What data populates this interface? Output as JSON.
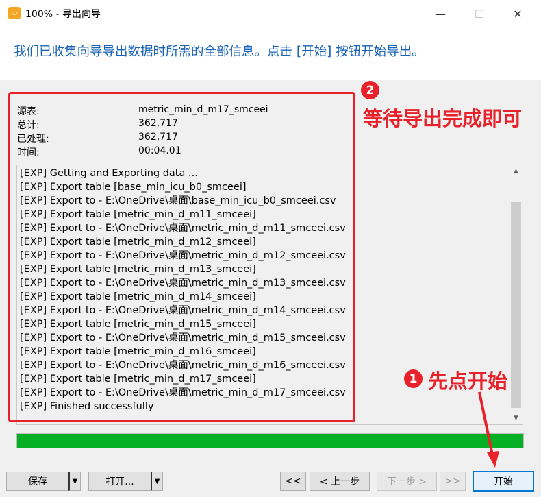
{
  "window": {
    "title": "100% - 导出向导",
    "minimize_glyph": "—",
    "maximize_glyph": "☐",
    "close_glyph": "✕"
  },
  "header": {
    "message": "我们已收集向导导出数据时所需的全部信息。点击 [开始] 按钮开始导出。"
  },
  "summary": [
    {
      "label": "源表:",
      "value": "metric_min_d_m17_smceei"
    },
    {
      "label": "总计:",
      "value": "362,717"
    },
    {
      "label": "已处理:",
      "value": "362,717"
    },
    {
      "label": "时间:",
      "value": "00:04.01"
    }
  ],
  "log": [
    "[EXP] Getting and Exporting data ...",
    "[EXP] Export table [base_min_icu_b0_smceei]",
    "[EXP] Export to - E:\\OneDrive\\桌面\\base_min_icu_b0_smceei.csv",
    "[EXP] Export table [metric_min_d_m11_smceei]",
    "[EXP] Export to - E:\\OneDrive\\桌面\\metric_min_d_m11_smceei.csv",
    "[EXP] Export table [metric_min_d_m12_smceei]",
    "[EXP] Export to - E:\\OneDrive\\桌面\\metric_min_d_m12_smceei.csv",
    "[EXP] Export table [metric_min_d_m13_smceei]",
    "[EXP] Export to - E:\\OneDrive\\桌面\\metric_min_d_m13_smceei.csv",
    "[EXP] Export table [metric_min_d_m14_smceei]",
    "[EXP] Export to - E:\\OneDrive\\桌面\\metric_min_d_m14_smceei.csv",
    "[EXP] Export table [metric_min_d_m15_smceei]",
    "[EXP] Export to - E:\\OneDrive\\桌面\\metric_min_d_m15_smceei.csv",
    "[EXP] Export table [metric_min_d_m16_smceei]",
    "[EXP] Export to - E:\\OneDrive\\桌面\\metric_min_d_m16_smceei.csv",
    "[EXP] Export table [metric_min_d_m17_smceei]",
    "[EXP] Export to - E:\\OneDrive\\桌面\\metric_min_d_m17_smceei.csv",
    "[EXP] Finished successfully"
  ],
  "progress": {
    "fraction": 1.0,
    "color": "#06b025"
  },
  "buttons": {
    "save": "保存",
    "open": "打开...",
    "first": "<<",
    "prev": "< 上一步",
    "next": "下一步 >",
    "last": ">>",
    "start": "开始"
  },
  "annotations": {
    "color": "#e8212a",
    "badge1": "1",
    "badge2": "2",
    "note1": "先点开始",
    "note2": "等待导出完成即可"
  }
}
